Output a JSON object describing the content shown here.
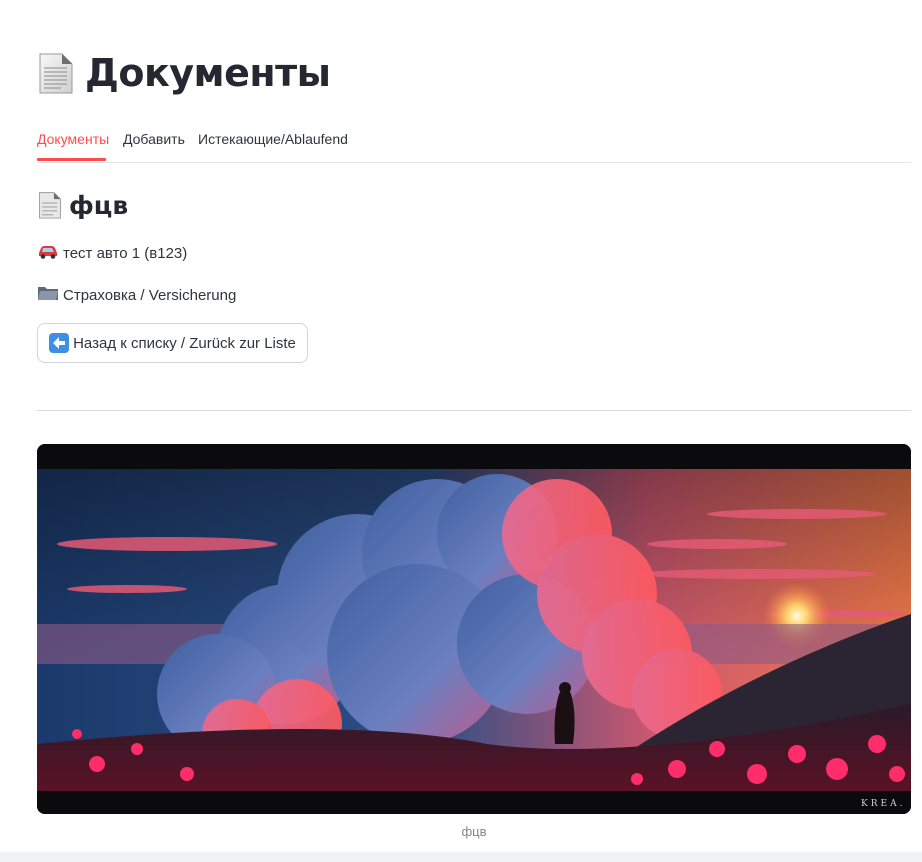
{
  "page": {
    "title": "Документы",
    "icon": "document-icon"
  },
  "tabs": [
    {
      "label": "Документы",
      "active": true
    },
    {
      "label": "Добавить",
      "active": false
    },
    {
      "label": "Истекающие/Ablaufend",
      "active": false
    }
  ],
  "document": {
    "title": "фцв",
    "icon": "document-icon",
    "car_text": "тест авто 1 (в123)",
    "car_icon": "car-icon",
    "category_text": "Страховка / Versicherung",
    "category_icon": "folder-icon"
  },
  "actions": {
    "back_label": "Назад к списку / Zurück zur Liste",
    "back_icon": "left-arrow-icon"
  },
  "image": {
    "caption": "фцв",
    "watermark": "KREA."
  },
  "colors": {
    "accent": "#ff4b4b",
    "text": "#31333f"
  }
}
